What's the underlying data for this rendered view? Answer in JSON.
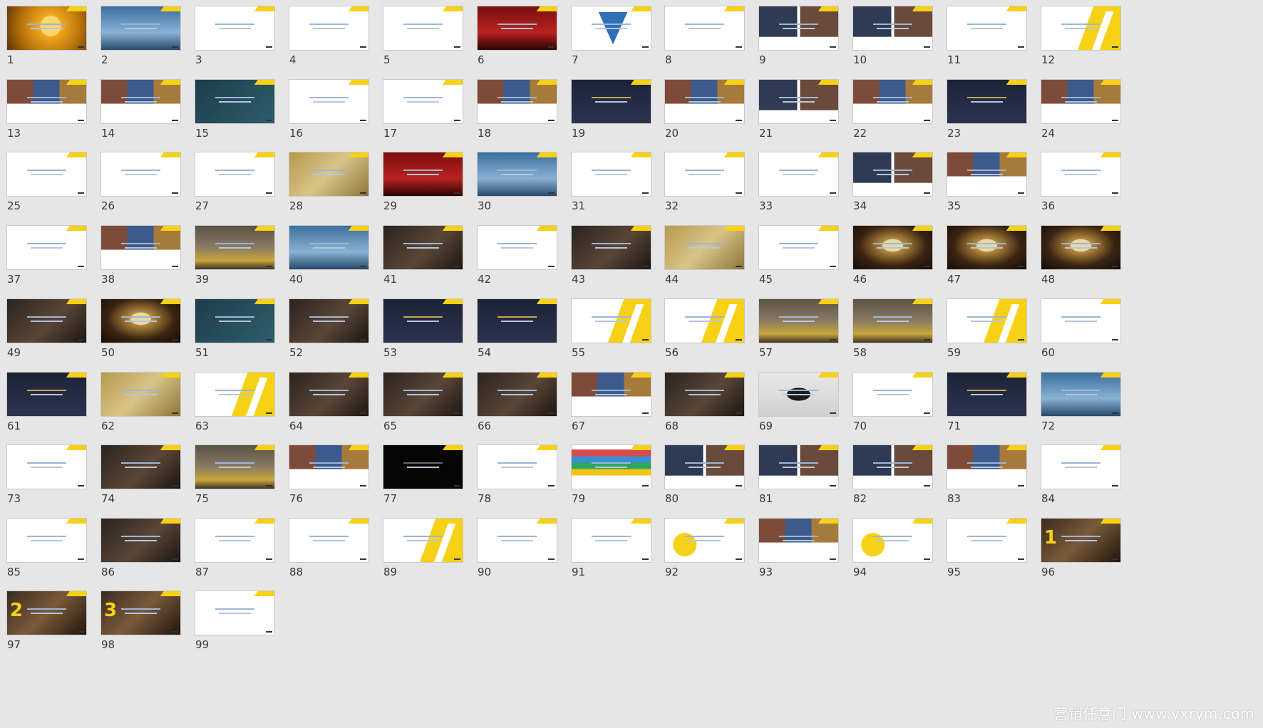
{
  "slides": [
    {
      "n": "1",
      "style": "sunset"
    },
    {
      "n": "2",
      "style": "blue"
    },
    {
      "n": "3",
      "style": "white"
    },
    {
      "n": "4",
      "style": "white"
    },
    {
      "n": "5",
      "style": "white"
    },
    {
      "n": "6",
      "style": "red"
    },
    {
      "n": "7",
      "style": "pyramid"
    },
    {
      "n": "8",
      "style": "white"
    },
    {
      "n": "9",
      "style": "photos"
    },
    {
      "n": "10",
      "style": "photos"
    },
    {
      "n": "11",
      "style": "white"
    },
    {
      "n": "12",
      "style": "yellow"
    },
    {
      "n": "13",
      "style": "collage"
    },
    {
      "n": "14",
      "style": "collage"
    },
    {
      "n": "15",
      "style": "teal"
    },
    {
      "n": "16",
      "style": "white"
    },
    {
      "n": "17",
      "style": "white"
    },
    {
      "n": "18",
      "style": "collage"
    },
    {
      "n": "19",
      "style": "navy"
    },
    {
      "n": "20",
      "style": "collage"
    },
    {
      "n": "21",
      "style": "photos"
    },
    {
      "n": "22",
      "style": "collage"
    },
    {
      "n": "23",
      "style": "navy"
    },
    {
      "n": "24",
      "style": "collage"
    },
    {
      "n": "25",
      "style": "white"
    },
    {
      "n": "26",
      "style": "white"
    },
    {
      "n": "27",
      "style": "white"
    },
    {
      "n": "28",
      "style": "gold"
    },
    {
      "n": "29",
      "style": "red"
    },
    {
      "n": "30",
      "style": "blue"
    },
    {
      "n": "31",
      "style": "white"
    },
    {
      "n": "32",
      "style": "white"
    },
    {
      "n": "33",
      "style": "white"
    },
    {
      "n": "34",
      "style": "photos"
    },
    {
      "n": "35",
      "style": "collage"
    },
    {
      "n": "36",
      "style": "white"
    },
    {
      "n": "37",
      "style": "white"
    },
    {
      "n": "38",
      "style": "collage"
    },
    {
      "n": "39",
      "style": "street"
    },
    {
      "n": "40",
      "style": "blue"
    },
    {
      "n": "41",
      "style": "dark"
    },
    {
      "n": "42",
      "style": "white"
    },
    {
      "n": "43",
      "style": "dark"
    },
    {
      "n": "44",
      "style": "gold"
    },
    {
      "n": "45",
      "style": "white"
    },
    {
      "n": "46",
      "style": "mask"
    },
    {
      "n": "47",
      "style": "mask"
    },
    {
      "n": "48",
      "style": "mask"
    },
    {
      "n": "49",
      "style": "dark"
    },
    {
      "n": "50",
      "style": "mask"
    },
    {
      "n": "51",
      "style": "teal"
    },
    {
      "n": "52",
      "style": "dark"
    },
    {
      "n": "53",
      "style": "navy"
    },
    {
      "n": "54",
      "style": "navy"
    },
    {
      "n": "55",
      "style": "yellow"
    },
    {
      "n": "56",
      "style": "yellow"
    },
    {
      "n": "57",
      "style": "street"
    },
    {
      "n": "58",
      "style": "street"
    },
    {
      "n": "59",
      "style": "yellow"
    },
    {
      "n": "60",
      "style": "white"
    },
    {
      "n": "61",
      "style": "navy"
    },
    {
      "n": "62",
      "style": "gold"
    },
    {
      "n": "63",
      "style": "yellow"
    },
    {
      "n": "64",
      "style": "dark"
    },
    {
      "n": "65",
      "style": "dark"
    },
    {
      "n": "66",
      "style": "dark"
    },
    {
      "n": "67",
      "style": "collage"
    },
    {
      "n": "68",
      "style": "dark"
    },
    {
      "n": "69",
      "style": "phone"
    },
    {
      "n": "70",
      "style": "white"
    },
    {
      "n": "71",
      "style": "navy"
    },
    {
      "n": "72",
      "style": "blue"
    },
    {
      "n": "73",
      "style": "white"
    },
    {
      "n": "74",
      "style": "dark"
    },
    {
      "n": "75",
      "style": "street"
    },
    {
      "n": "76",
      "style": "collage"
    },
    {
      "n": "77",
      "style": "black"
    },
    {
      "n": "78",
      "style": "white"
    },
    {
      "n": "79",
      "style": "books"
    },
    {
      "n": "80",
      "style": "photos"
    },
    {
      "n": "81",
      "style": "photos"
    },
    {
      "n": "82",
      "style": "photos"
    },
    {
      "n": "83",
      "style": "collage"
    },
    {
      "n": "84",
      "style": "white"
    },
    {
      "n": "85",
      "style": "white"
    },
    {
      "n": "86",
      "style": "dark"
    },
    {
      "n": "87",
      "style": "white"
    },
    {
      "n": "88",
      "style": "white"
    },
    {
      "n": "89",
      "style": "yellow"
    },
    {
      "n": "90",
      "style": "white"
    },
    {
      "n": "91",
      "style": "white"
    },
    {
      "n": "92",
      "style": "yellowcircle"
    },
    {
      "n": "93",
      "style": "collage"
    },
    {
      "n": "94",
      "style": "yellowcircle"
    },
    {
      "n": "95",
      "style": "white"
    },
    {
      "n": "96",
      "style": "numbered",
      "badge": "1"
    },
    {
      "n": "97",
      "style": "numbered",
      "badge": "2"
    },
    {
      "n": "98",
      "style": "numbered",
      "badge": "3"
    },
    {
      "n": "99",
      "style": "white"
    }
  ],
  "watermark": "营销任意门 www.yxrym.com",
  "accent_color": "#f7d116"
}
